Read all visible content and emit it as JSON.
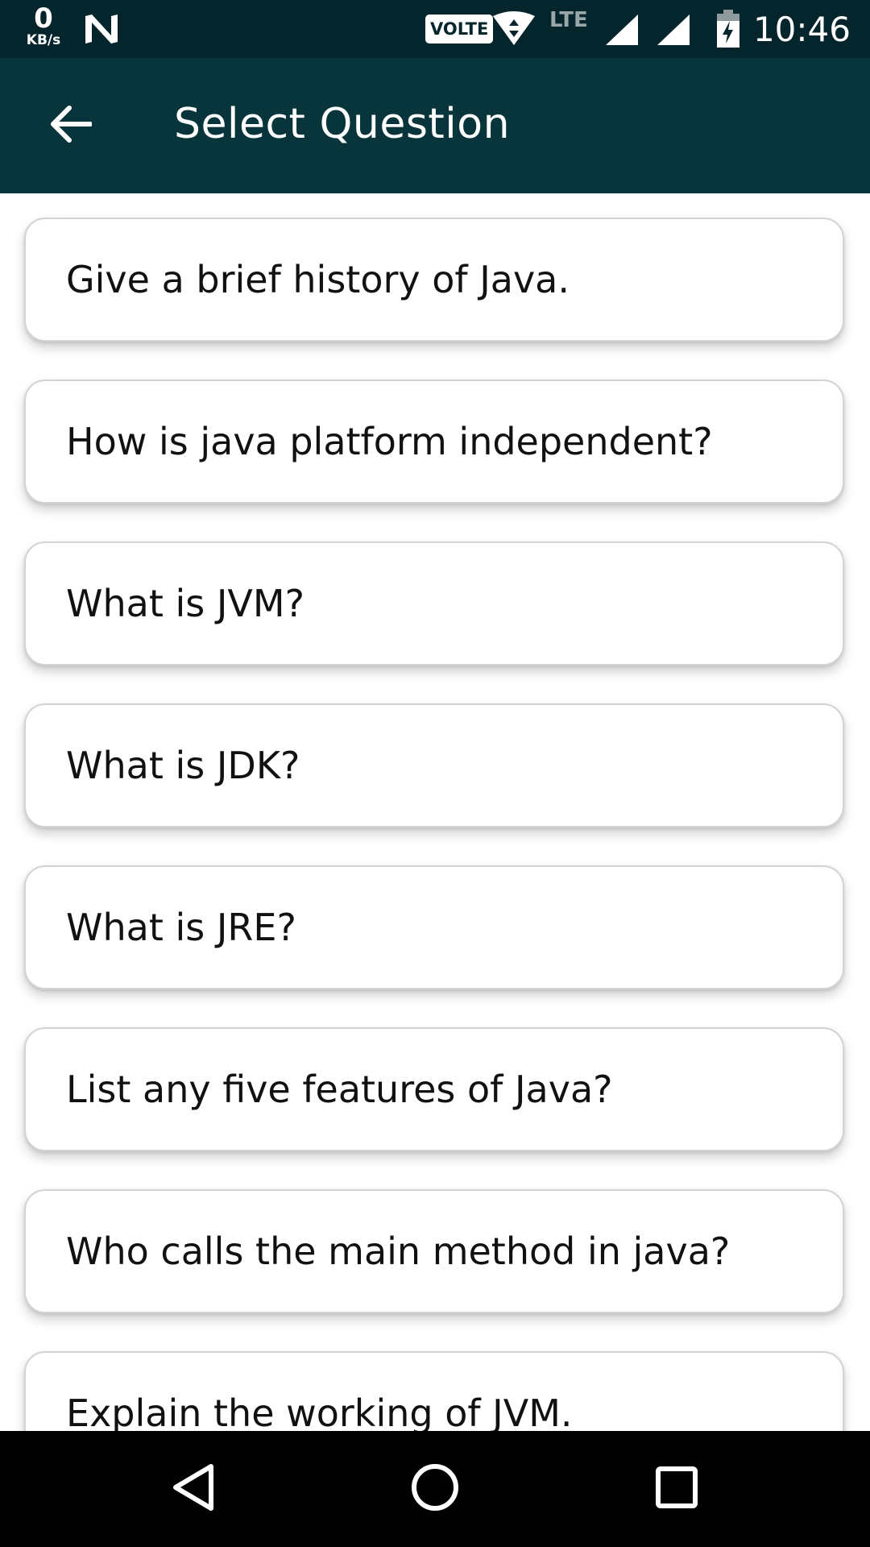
{
  "status_bar": {
    "net_speed_value": "0",
    "net_speed_unit": "KB/s",
    "volte": "VOLTE",
    "lte": "LTE",
    "time": "10:46",
    "icons": [
      "n-notification-icon",
      "wifi-icon",
      "signal-icon",
      "signal-icon",
      "battery-charging-icon"
    ]
  },
  "app_bar": {
    "title": "Select Question",
    "back_icon": "arrow-left-icon"
  },
  "questions": [
    "Give a brief history of Java.",
    "How is java platform independent?",
    "What is JVM?",
    "What is JDK?",
    "What is JRE?",
    "List any five features of Java?",
    "Who calls the main method in java?",
    "Explain the working of JVM."
  ],
  "nav_bar": {
    "icons": [
      "back-triangle-icon",
      "home-circle-icon",
      "recents-square-icon"
    ]
  },
  "colors": {
    "status_bar": "#04252c",
    "app_bar": "#08343b",
    "card_border": "#d3d3d3",
    "nav_bar": "#000000"
  }
}
